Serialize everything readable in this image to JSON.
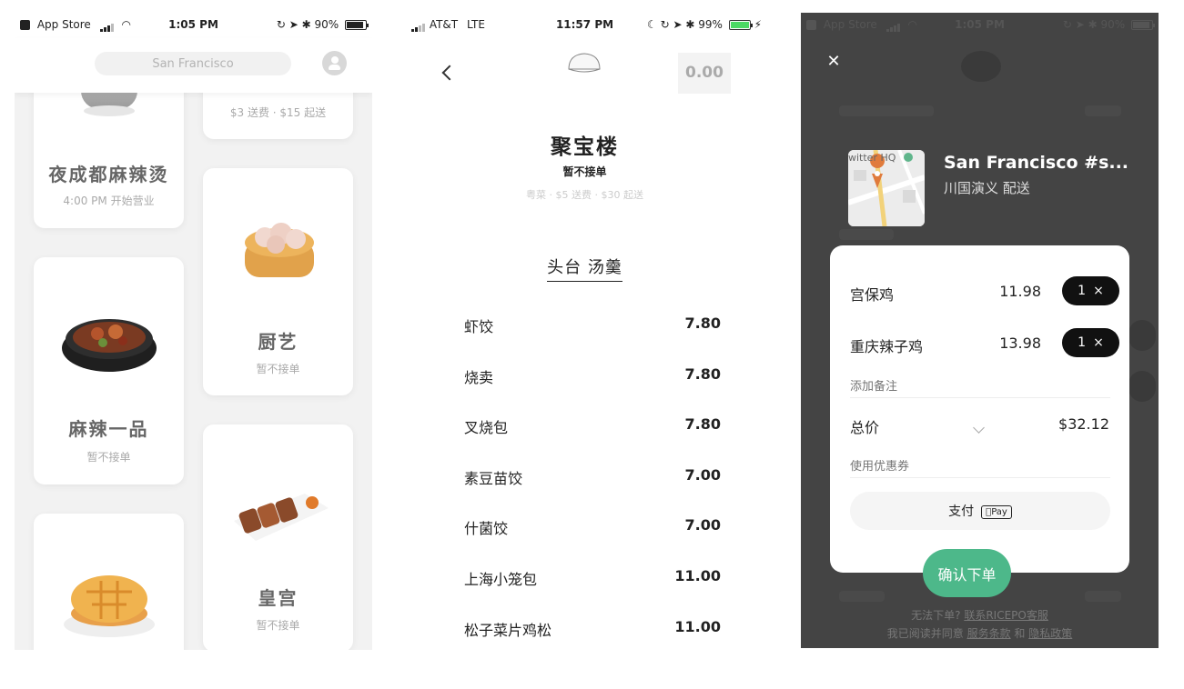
{
  "phone1": {
    "status": {
      "carrier": "App Store",
      "time": "1:05 PM",
      "battery": "90%"
    },
    "search": {
      "value": "San Francisco"
    },
    "restaurants": [
      {
        "name": "",
        "sub": "$3 送费 · $15 起送"
      },
      {
        "name": "夜成都麻辣烫",
        "sub": "4:00 PM 开始营业"
      },
      {
        "name": "厨艺",
        "sub": "暂不接单"
      },
      {
        "name": "麻辣一品",
        "sub": "暂不接单"
      },
      {
        "name": "皇宫",
        "sub": "暂不接单"
      }
    ]
  },
  "phone2": {
    "status": {
      "carrier": "AT&T",
      "network": "LTE",
      "time": "11:57 PM",
      "battery": "99%"
    },
    "cart_total": "0.00",
    "restaurant_name": "聚宝楼",
    "restaurant_status": "暂不接单",
    "restaurant_info": "粤菜 · $5 送费 · $30 起送",
    "section_title": "头台 汤羹",
    "menu": [
      {
        "name": "虾饺",
        "price": "7.80"
      },
      {
        "name": "烧卖",
        "price": "7.80"
      },
      {
        "name": "叉烧包",
        "price": "7.80"
      },
      {
        "name": "素豆苗饺",
        "price": "7.00"
      },
      {
        "name": "什菌饺",
        "price": "7.00"
      },
      {
        "name": "上海小笼包",
        "price": "11.00"
      },
      {
        "name": "松子菜片鸡松",
        "price": "11.00"
      }
    ]
  },
  "phone3": {
    "status": {
      "carrier": "App Store",
      "time": "1:05 PM",
      "battery": "90%"
    },
    "map_label": "witter HQ",
    "store_title": "San Francisco #s...",
    "store_subtitle": "川国演义 配送",
    "order": [
      {
        "name": "宫保鸡",
        "price": "11.98",
        "qty": "1"
      },
      {
        "name": "重庆辣子鸡",
        "price": "13.98",
        "qty": "1"
      }
    ],
    "qty_remove": "×",
    "note_placeholder": "添加备注",
    "total_label": "总价",
    "total_value": "$32.12",
    "coupon_placeholder": "使用优惠券",
    "pay_label": "支付",
    "pay_method": "Pay",
    "confirm_label": "确认下单",
    "footer": {
      "line1_prefix": "无法下单?",
      "line1_link": "联系RICEPO客服",
      "line2_prefix": "我已阅读并同意",
      "terms": "服务条款",
      "and": "和",
      "privacy": "隐私政策"
    },
    "accent_color": "#4db88a"
  }
}
